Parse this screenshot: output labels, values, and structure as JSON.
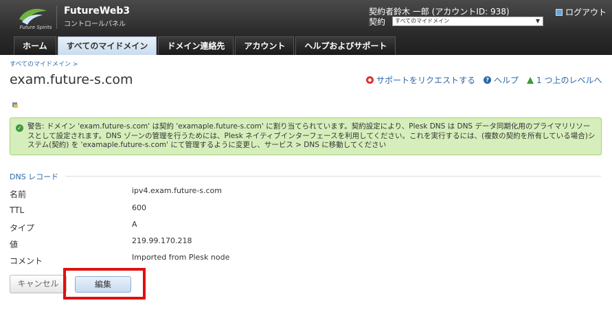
{
  "header": {
    "logo_text": "Future Spirits",
    "brand_title": "FutureWeb3",
    "brand_subtitle": "コントロールパネル",
    "account_line": "契約者鈴木 一郎 (アカウントID: 938)",
    "contract_label": "契約",
    "contract_value": "すべてのマイドメイン",
    "logout_label": "ログアウト"
  },
  "tabs": [
    {
      "label": "ホーム"
    },
    {
      "label": "すべてのマイドメイン"
    },
    {
      "label": "ドメイン連絡先"
    },
    {
      "label": "アカウント"
    },
    {
      "label": "ヘルプおよびサポート"
    }
  ],
  "breadcrumb": "すべてのマイドメイン >",
  "page_title": "exam.future-s.com",
  "actions": {
    "support": "サポートをリクエストする",
    "help": "ヘルプ",
    "up_level": "1 つ上のレベルへ"
  },
  "warning_text": "警告: ドメイン 'exam.future-s.com' は契約 'examaple.future-s.com' に割り当てられています。契約設定により、Plesk DNS は DNS データ同期化用のプライマリリソースとして設定されます。DNS ゾーンの管理を行うためには、Plesk ネイティブインターフェースを利用してください。これを実行するには、(複数の契約を所有している場合)システム(契約) を 'examaple.future-s.com' にて管理するように変更し、サービス > DNS に移動してください",
  "dns_section_title": "DNS レコード",
  "dns_records": [
    {
      "label": "名前",
      "value": "ipv4.exam.future-s.com"
    },
    {
      "label": "TTL",
      "value": "600"
    },
    {
      "label": "タイプ",
      "value": "A"
    },
    {
      "label": "値",
      "value": "219.99.170.218"
    },
    {
      "label": "コメント",
      "value": "Imported from Plesk node"
    }
  ],
  "buttons": {
    "cancel": "キャンセル",
    "edit": "編集"
  },
  "colors": {
    "link": "#2a67a8",
    "highlight": "#e01010",
    "warning_bg": "#d6eebb"
  }
}
